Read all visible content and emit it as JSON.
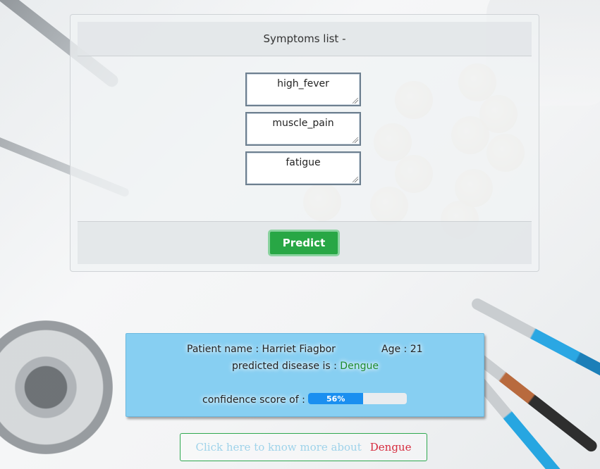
{
  "symptoms_card": {
    "header": "Symptoms list -",
    "symptoms": [
      "high_fever",
      "muscle_pain",
      "fatigue"
    ],
    "predict_label": "Predict"
  },
  "result": {
    "patient_name": "Patient name : Harriet Fiagbor",
    "age": "Age : 21",
    "predicted_label": "predicted disease is :",
    "disease": "Dengue",
    "confidence_label": "confidence score of :",
    "confidence_text": "56%",
    "confidence_value": 56
  },
  "more_info": {
    "link_text": "Click here to know more about",
    "disease": "Dengue"
  },
  "colors": {
    "predict_button": "#28a745",
    "result_panel": "#87cff2",
    "progress": "#1a8ff0",
    "disease_link": "#d62b3e"
  }
}
